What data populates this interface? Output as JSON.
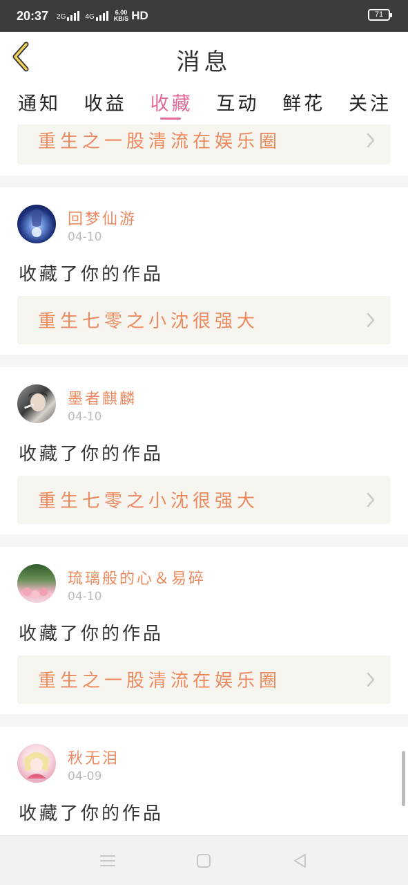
{
  "status_bar": {
    "time": "20:37",
    "net1": "2G",
    "net2": "4G",
    "speed_value": "6.00",
    "speed_unit": "KB/S",
    "hd": "HD",
    "battery": "71"
  },
  "header": {
    "title": "消息",
    "back_icon": "chevron-left-icon"
  },
  "tabs": [
    {
      "label": "通知",
      "active": false
    },
    {
      "label": "收益",
      "active": false
    },
    {
      "label": "收藏",
      "active": true
    },
    {
      "label": "互动",
      "active": false
    },
    {
      "label": "鲜花",
      "active": false
    },
    {
      "label": "关注",
      "active": false
    }
  ],
  "colors": {
    "accent": "#e46a9b",
    "name": "#ec8a5f",
    "work_bg": "#f6f5ef"
  },
  "feed": {
    "partial_top": {
      "work_title": "重生之一股清流在娱乐圈"
    },
    "items": [
      {
        "name": "回梦仙游",
        "date": "04-10",
        "action": "收藏了你的作品",
        "work_title": "重生七零之小沈很强大"
      },
      {
        "name": "墨者麒麟",
        "date": "04-10",
        "action": "收藏了你的作品",
        "work_title": "重生七零之小沈很强大"
      },
      {
        "name": "琉璃般的心＆易碎",
        "date": "04-10",
        "action": "收藏了你的作品",
        "work_title": "重生之一股清流在娱乐圈"
      },
      {
        "name": "秋无泪",
        "date": "04-09",
        "action": "收藏了你的作品",
        "work_title": ""
      }
    ]
  },
  "nav_bar": {
    "icons": [
      "menu-icon",
      "home-square-icon",
      "back-triangle-icon"
    ]
  }
}
